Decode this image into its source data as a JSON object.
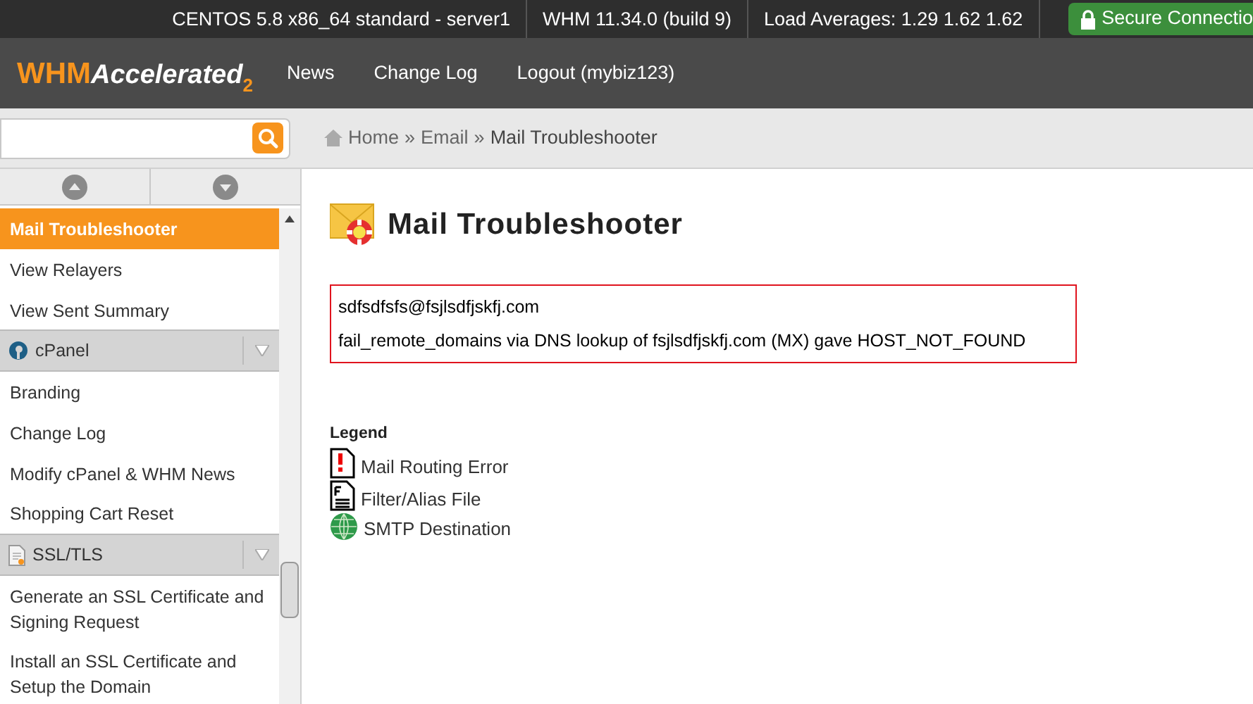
{
  "top_bar": {
    "items": [
      "CENTOS 5.8 x86_64 standard - server1",
      "WHM 11.34.0 (build 9)",
      "Load Averages: 1.29 1.62 1.62"
    ],
    "secure": "Secure Connectio"
  },
  "header": {
    "logo": {
      "main": "WHM",
      "accent": "Accelerated",
      "version": "2"
    },
    "nav": [
      "News",
      "Change Log",
      "Logout (mybiz123)"
    ]
  },
  "breadcrumb": {
    "items": [
      "Home",
      "Email",
      "Mail Troubleshooter"
    ],
    "separator": "»"
  },
  "sidebar": {
    "items": [
      {
        "kind": "item",
        "label": "Mail Troubleshooter",
        "selected": true
      },
      {
        "kind": "item",
        "label": "View Relayers",
        "selected": false
      },
      {
        "kind": "item",
        "label": "View Sent Summary",
        "selected": false
      },
      {
        "kind": "cpanel",
        "label": "cPanel"
      },
      {
        "kind": "item",
        "label": "Branding",
        "selected": false
      },
      {
        "kind": "item",
        "label": "Change Log",
        "selected": false
      },
      {
        "kind": "item",
        "label": "Modify cPanel & WHM News",
        "selected": false
      },
      {
        "kind": "item",
        "label": "Shopping Cart Reset",
        "selected": false
      },
      {
        "kind": "ssl",
        "label": "SSL/TLS"
      },
      {
        "kind": "item",
        "label": "Generate an SSL Certificate and Signing Request",
        "selected": false
      },
      {
        "kind": "item",
        "label": "Install an SSL Certificate and Setup the Domain",
        "selected": false
      }
    ]
  },
  "page": {
    "title": "Mail Troubleshooter",
    "result": [
      "sdfsdfsfs@fsjlsdfjskfj.com",
      "fail_remote_domains via DNS lookup of fsjlsdfjskfj.com (MX) gave HOST_NOT_FOUND"
    ],
    "legend": {
      "title": "Legend",
      "entries": [
        {
          "kind": "error",
          "label": "Mail Routing Error"
        },
        {
          "kind": "file",
          "label": "Filter/Alias File"
        },
        {
          "kind": "smtp",
          "label": "SMTP Destination"
        }
      ]
    }
  }
}
